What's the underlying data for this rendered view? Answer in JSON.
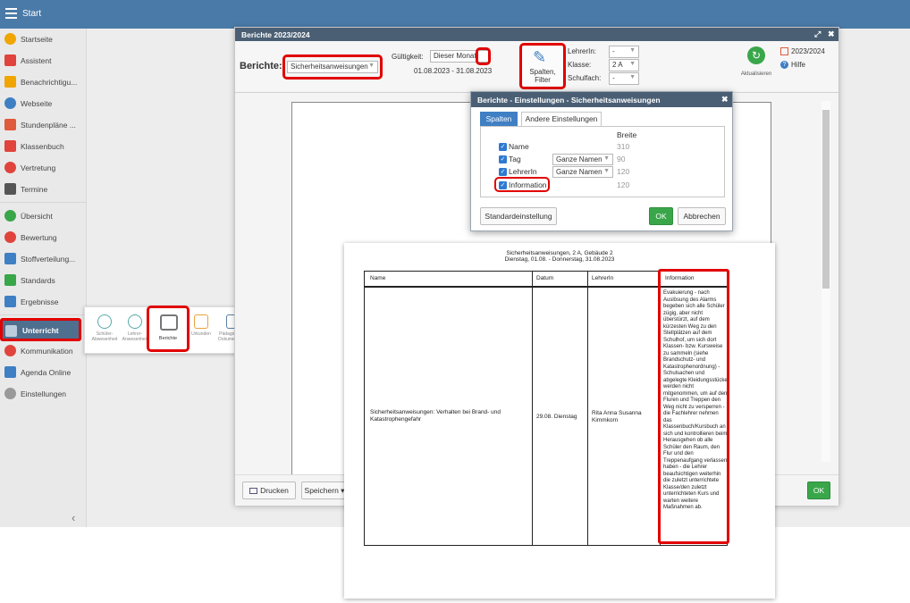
{
  "topbar": {
    "title": "Start"
  },
  "sidebar": {
    "items": [
      {
        "label": "Startseite",
        "icon": "star-icon",
        "color": "#f0a500"
      },
      {
        "label": "Assistent",
        "icon": "wand-icon",
        "color": "#e0443c"
      },
      {
        "label": "Benachrichtigu...",
        "icon": "envelope-icon",
        "color": "#f0a500"
      },
      {
        "label": "Webseite",
        "icon": "globe-icon",
        "color": "#3f7fc4"
      },
      {
        "label": "Stundenpläne ...",
        "icon": "calendar-icon",
        "color": "#e05a3c"
      },
      {
        "label": "Klassenbuch",
        "icon": "book-icon",
        "color": "#e0443c"
      },
      {
        "label": "Vertretung",
        "icon": "person-icon",
        "color": "#e0443c"
      },
      {
        "label": "Termine",
        "icon": "calendar-icon",
        "color": "#555555"
      },
      {
        "label": "Übersicht",
        "icon": "check-icon",
        "color": "#3aa64a"
      },
      {
        "label": "Bewertung",
        "icon": "grade-icon",
        "color": "#e0443c"
      },
      {
        "label": "Stoffverteilung...",
        "icon": "folder-icon",
        "color": "#3f7fc4"
      },
      {
        "label": "Standards",
        "icon": "shield-icon",
        "color": "#3aa64a"
      },
      {
        "label": "Ergebnisse",
        "icon": "bar-chart-icon",
        "color": "#3f7fc4"
      },
      {
        "label": "Unterricht",
        "icon": "book-open-icon",
        "color": "#4f6f8f"
      },
      {
        "label": "Kommunikation",
        "icon": "chat-icon",
        "color": "#e0443c"
      },
      {
        "label": "Agenda Online",
        "icon": "pencil-icon",
        "color": "#3f7fc4"
      },
      {
        "label": "Einstellungen",
        "icon": "gear-icon",
        "color": "#999999"
      }
    ]
  },
  "flyout": {
    "items": [
      {
        "label": "Schüler-\nAbwesenheit",
        "icon": "student-icon"
      },
      {
        "label": "Lehrer-\nAnwesenheit",
        "icon": "teacher-icon"
      },
      {
        "label": "Berichte",
        "icon": "printer-icon"
      },
      {
        "label": "Urkunden",
        "icon": "certificate-icon"
      },
      {
        "label": "Pädagogische\nDokumentation",
        "icon": "document-icon"
      }
    ]
  },
  "dialog": {
    "title": "Berichte 2023/2024",
    "reports_label": "Berichte:",
    "report_value": "Sicherheitsanweisungen",
    "validity_label": "Gültigkeit:",
    "validity_value": "Dieser Monat",
    "date_range": "01.08.2023 - 31.08.2023",
    "columns_filter_label": "Spalten,\nFilter",
    "teacher_label": "LehrerIn:",
    "teacher_value": "-",
    "class_label": "Klasse:",
    "class_value": "2 A",
    "subject_label": "Schulfach:",
    "subject_value": "-",
    "refresh_label": "Aktualisieren",
    "year_value": "2023/2024",
    "help_label": "Hilfe",
    "print_label": "Drucken",
    "save_label": "Speichern",
    "ok_label": "OK"
  },
  "settings": {
    "title": "Berichte - Einstellungen - Sicherheitsanweisungen",
    "tabs": [
      "Spalten",
      "Andere Einstellungen"
    ],
    "width_header": "Breite",
    "rows": [
      {
        "label": "Name",
        "option": "",
        "width": "310"
      },
      {
        "label": "Tag",
        "option": "Ganze Namen",
        "width": "90"
      },
      {
        "label": "LehrerIn",
        "option": "Ganze Namen",
        "width": "120"
      },
      {
        "label": "Information",
        "option": "",
        "width": "120"
      }
    ],
    "default_button": "Standardeinstellung",
    "ok_button": "OK",
    "cancel_button": "Abbrechen"
  },
  "report": {
    "title": "Sicherheitsanweisungen, 2 A, Gebäude 2",
    "subtitle": "Dienstag, 01.08. - Donnerstag, 31.08.2023",
    "columns": [
      "Name",
      "Datum",
      "LehrerIn",
      "Information"
    ],
    "row": {
      "name": "Sicherheitsanweisungen: Verhalten bei Brand- und Katastrophengefahr",
      "date": "29.08. Dienstag",
      "teacher": "Rita Anna Susanna Kimmkorn",
      "information": "Evakuierung - nach Auslösung des Alarms begeben sich alle Schüler zügig, aber nicht überstürzt, auf dem kürzesten Weg zu den Stellplätzen auf dem Schulhof, um sich dort Klassen- bzw. Kursweise zu sammeln (siehe Brandschutz- und Katastrophenordnung) - Schulsachen und abgelegte Kleidungsstücke werden nicht mitgenommen, um auf den Fluren und Treppen den Weg nicht zu versperren - die Fachlehrer nehmen das Klassenbuch/Kursbuch an sich und kontrollieren beim Herausgehen ob alle Schüler den Raum, den Flur und den Treppenaufgang verlassen haben - die Lehrer beaufsichtigen weiterhin die zuletzt unterrichtete Klasse/den zuletzt unterrichteten Kurs und warten weitere Maßnahmen ab."
    }
  }
}
